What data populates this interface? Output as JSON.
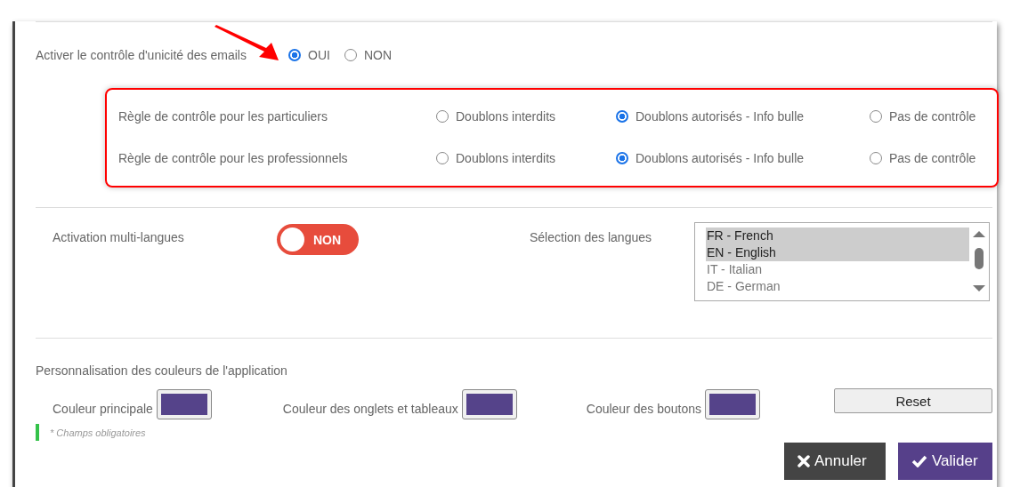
{
  "email_uniqueness": {
    "label": "Activer le contrôle d'unicité des emails",
    "options": [
      {
        "label": "OUI",
        "selected": true
      },
      {
        "label": "NON",
        "selected": false
      }
    ]
  },
  "rules": [
    {
      "label": "Règle de contrôle pour les particuliers",
      "options": [
        {
          "label": "Doublons interdits",
          "selected": false
        },
        {
          "label": "Doublons autorisés - Info bulle",
          "selected": true
        },
        {
          "label": "Pas de contrôle",
          "selected": false
        }
      ]
    },
    {
      "label": "Règle de contrôle pour les professionnels",
      "options": [
        {
          "label": "Doublons interdits",
          "selected": false
        },
        {
          "label": "Doublons autorisés - Info bulle",
          "selected": true
        },
        {
          "label": "Pas de contrôle",
          "selected": false
        }
      ]
    }
  ],
  "multilang": {
    "label": "Activation multi-langues",
    "toggle": {
      "label": "NON",
      "on": false
    }
  },
  "languages": {
    "label": "Sélection des langues",
    "items": [
      {
        "label": "FR - French",
        "selected": true
      },
      {
        "label": "EN - English",
        "selected": true
      },
      {
        "label": "IT - Italian",
        "selected": false
      },
      {
        "label": "DE - German",
        "selected": false
      }
    ]
  },
  "colors": {
    "title": "Personnalisation des couleurs de l'application",
    "fields": [
      {
        "label": "Couleur principale",
        "color": "#55438a"
      },
      {
        "label": "Couleur des onglets et tableaux",
        "color": "#55438a"
      },
      {
        "label": "Couleur des boutons",
        "color": "#55438a"
      }
    ],
    "reset": "Reset"
  },
  "required_note": "* Champs obligatoires",
  "buttons": {
    "cancel": "Annuler",
    "submit": "Valider"
  }
}
